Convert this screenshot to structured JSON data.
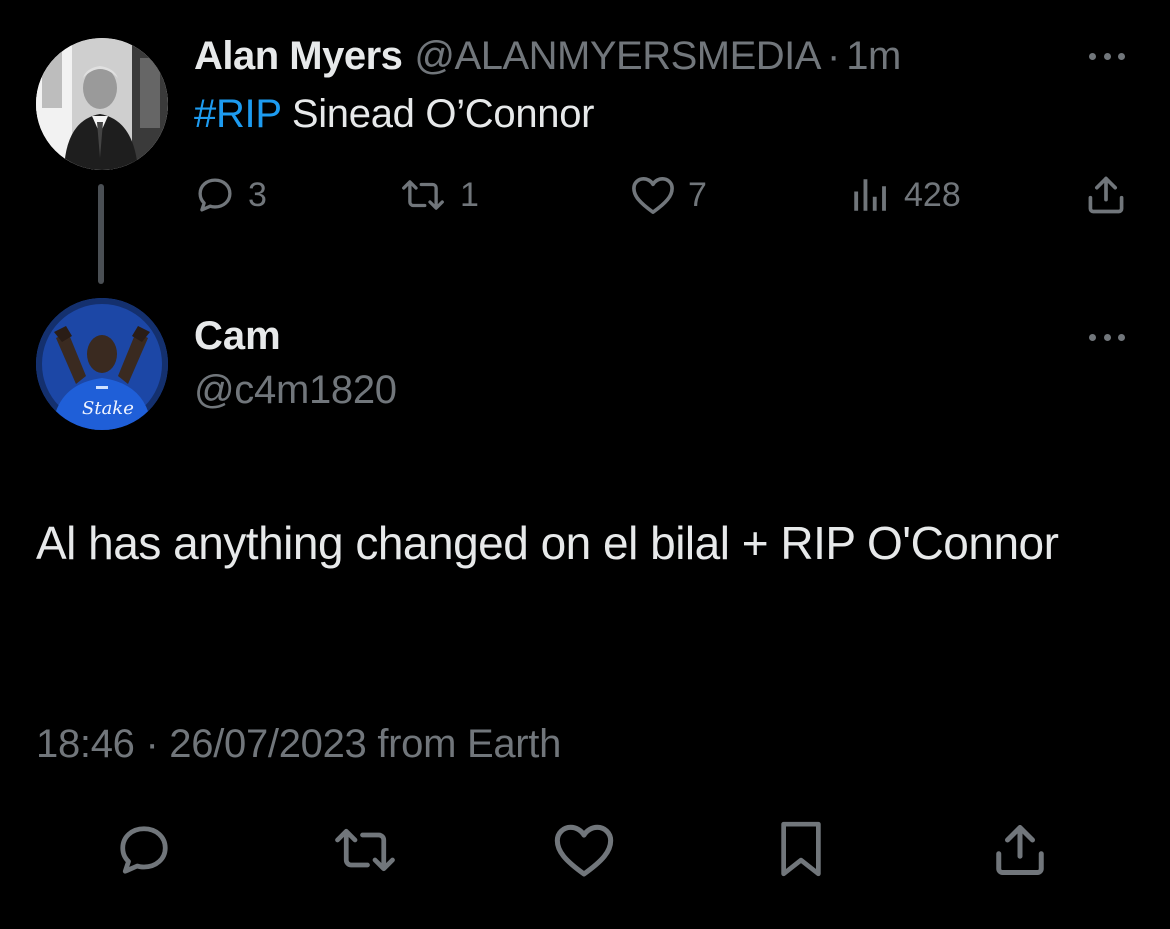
{
  "parent_tweet": {
    "author_name": "Alan Myers",
    "author_handle": "@ALANMYERSMEDIA",
    "separator": "·",
    "time_ago": "1m",
    "hashtag": "#RIP",
    "text": " Sinead O’Connor",
    "actions": {
      "reply_count": "3",
      "retweet_count": "1",
      "like_count": "7",
      "view_count": "428"
    }
  },
  "reply_tweet": {
    "author_name": "Cam",
    "author_handle": "@c4m1820",
    "text": "Al has anything changed on el bilal + RIP O'Connor",
    "time": "18:46",
    "separator": "·",
    "date": "26/07/2023",
    "source": "from Earth",
    "avatar_shirt_text": "Stake"
  },
  "colors": {
    "background": "#000000",
    "text_primary": "#e7e9ea",
    "text_secondary": "#71767b",
    "link": "#1d9bf0",
    "thread_line": "#4a4f54"
  },
  "icons": [
    "more-icon",
    "reply-icon",
    "retweet-icon",
    "like-icon",
    "views-icon",
    "share-icon",
    "bookmark-icon"
  ]
}
